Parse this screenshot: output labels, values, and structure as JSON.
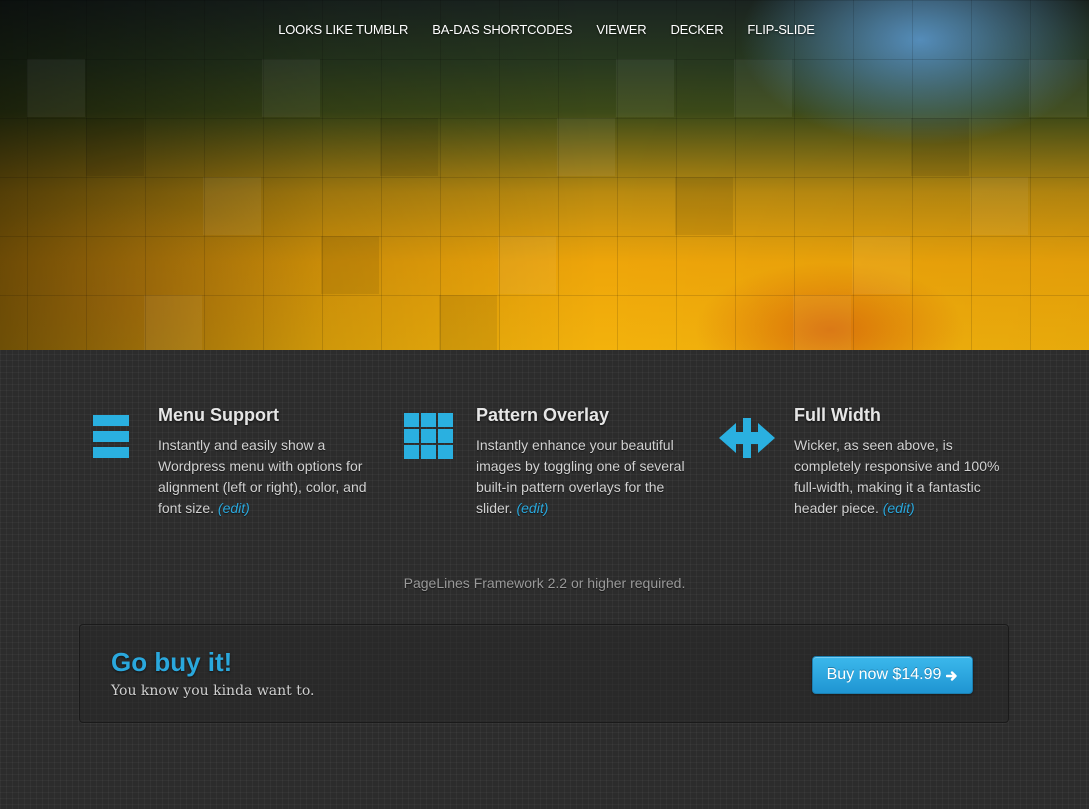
{
  "nav": {
    "items": [
      {
        "label": "LOOKS LIKE TUMBLR"
      },
      {
        "label": "BA-DAS SHORTCODES"
      },
      {
        "label": "VIEWER"
      },
      {
        "label": "DECKER"
      },
      {
        "label": "FLIP-SLIDE"
      }
    ]
  },
  "features": [
    {
      "icon": "menu-bars-icon",
      "title": "Menu Support",
      "body": "Instantly and easily show a Wordpress menu with options for alignment (left or right), color, and font size.",
      "edit_label": "(edit)"
    },
    {
      "icon": "grid-icon",
      "title": "Pattern Overlay",
      "body": "Instantly enhance your beautiful images by toggling one of several built-in pattern overlays for the slider.",
      "edit_label": "(edit)"
    },
    {
      "icon": "horizontal-resize-icon",
      "title": "Full Width",
      "body": "Wicker, as seen above, is completely responsive and 100% full-width, making it a fantastic header piece.",
      "edit_label": "(edit)"
    }
  ],
  "requirement_note": "PageLines Framework 2.2 or higher required.",
  "callout": {
    "title": "Go buy it!",
    "subtitle": "You know you kinda want to.",
    "button_label": "Buy now $14.99",
    "button_icon": "arrow-right-icon"
  },
  "colors": {
    "accent": "#2aa8dd",
    "button": "#2fa6e0",
    "background": "#2c2c2c",
    "hero_gold": "#f3b20c"
  }
}
